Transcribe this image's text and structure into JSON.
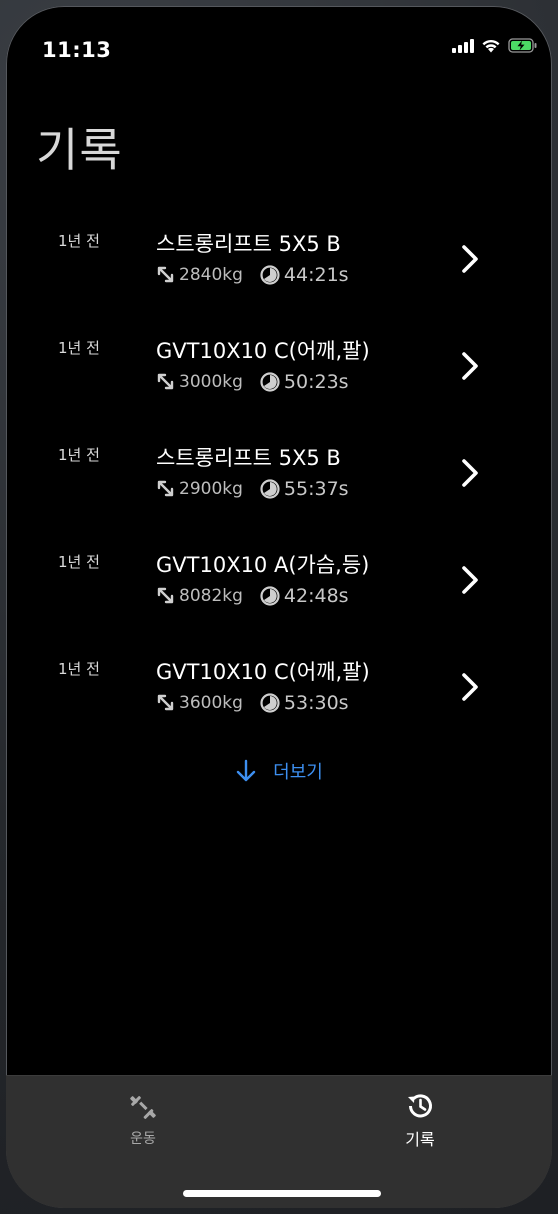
{
  "status_bar": {
    "time": "11:13",
    "icons": [
      "cellular-signal-icon",
      "wifi-icon",
      "battery-charging-icon"
    ]
  },
  "page": {
    "title": "기록"
  },
  "history": [
    {
      "when": "1년 전",
      "title": "스트롱리프트 5X5 B",
      "volume": "2840kg",
      "duration": "44:21s"
    },
    {
      "when": "1년 전",
      "title": "GVT10X10 C(어깨,팔)",
      "volume": "3000kg",
      "duration": "50:23s"
    },
    {
      "when": "1년 전",
      "title": "스트롱리프트 5X5 B",
      "volume": "2900kg",
      "duration": "55:37s"
    },
    {
      "when": "1년 전",
      "title": "GVT10X10 A(가슴,등)",
      "volume": "8082kg",
      "duration": "42:48s"
    },
    {
      "when": "1년 전",
      "title": "GVT10X10 C(어깨,팔)",
      "volume": "3600kg",
      "duration": "53:30s"
    }
  ],
  "load_more": {
    "label": "더보기"
  },
  "tab_bar": {
    "tabs": [
      {
        "label": "운동",
        "icon": "dumbbell-icon",
        "selected": false
      },
      {
        "label": "기록",
        "icon": "history-clock-icon",
        "selected": true
      }
    ]
  },
  "colors": {
    "background": "#000000",
    "accent": "#3d8ff0",
    "tab_bar": "#303030",
    "secondary_text": "#bdbdbd"
  }
}
